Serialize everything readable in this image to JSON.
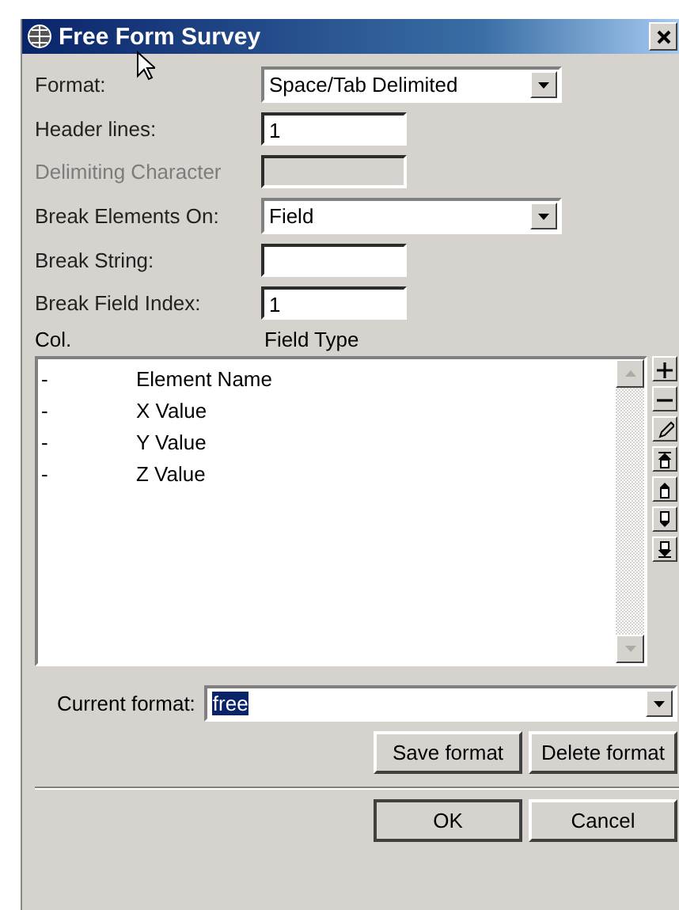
{
  "window": {
    "title": "Free Form Survey"
  },
  "fields": [
    {
      "label": "Format:",
      "kind": "dropdown",
      "value": "Space/Tab Delimited",
      "disabled": false
    },
    {
      "label": "Header lines:",
      "kind": "text",
      "value": "1",
      "disabled": false
    },
    {
      "label": "Delimiting Character",
      "kind": "text",
      "disabled": true
    },
    {
      "label": "Break Elements On:",
      "kind": "dropdown",
      "value": "Field",
      "disabled": false
    },
    {
      "label": "Break String:",
      "kind": "text",
      "disabled": false
    },
    {
      "label": "Break Field Index:",
      "kind": "text",
      "value": "1",
      "disabled": false
    }
  ],
  "list_headers": {
    "col": "Col.",
    "field_type": "Field Type"
  },
  "list_rows": [
    {
      "col": "-",
      "name": "Element Name"
    },
    {
      "col": "-",
      "name": "X Value"
    },
    {
      "col": "-",
      "name": "Y Value"
    },
    {
      "col": "-",
      "name": "Z Value"
    }
  ],
  "current_format": {
    "label": "Current format:",
    "value": "free",
    "highlighted": true
  },
  "format_buttons": [
    "Save format",
    "Delete format"
  ],
  "dialog_buttons": [
    "OK",
    "Cancel"
  ]
}
